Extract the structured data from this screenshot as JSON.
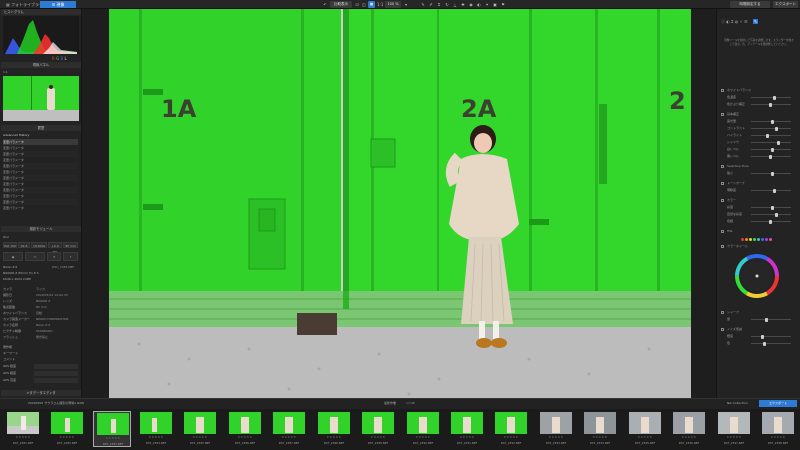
{
  "app": {
    "title": "フォトライブラリ",
    "tab_active": "現像"
  },
  "toolbar": {
    "compare_label": "比較表示",
    "zoom_label": "100 %",
    "right_btn1": "時間設定する",
    "right_btn2": "エクスポート",
    "menu1": "ファイル",
    "menu2": "ナビゲータ"
  },
  "left_panel": {
    "histogram_header": "ヒストグラム",
    "histogram_legend": [
      "R",
      "G",
      "B",
      "L"
    ],
    "navigator_header": "現像パネル",
    "navigator_zoom": "1:1",
    "history_header": "履歴",
    "history_title": "Advanced History",
    "history_items": [
      "変更パラメータ",
      "変更パラメータ",
      "変更パラメータ",
      "変更パラメータ",
      "変更パラメータ",
      "変更パラメータ",
      "変更パラメータ",
      "変更パラメータ",
      "変更パラメータ",
      "変更パラメータ",
      "変更パラメータ",
      "変更パラメータ"
    ],
    "snapshot_header": "撮影モジュール",
    "info_header": "Zoil",
    "camera_buttons": [
      "ISO 100",
      "f/2.8",
      "1/1000s",
      "+0.0 EV",
      "85 mm"
    ],
    "exif": [
      {
        "label": "Nikon Z 6",
        "value": "DSC_2383.NEF"
      },
      {
        "label": "NIKKOR Z 85mm f/1.8 S",
        "value": ""
      },
      {
        "label": "6048 x 4024 24MP",
        "value": ""
      },
      {
        "label": "カメラ",
        "value": "ライカ"
      },
      {
        "label": "撮影日",
        "value": "2020/03/02 14:02:33"
      },
      {
        "label": "レンズ",
        "value": "NIKKOR Z"
      },
      {
        "label": "焦点距離",
        "value": "85 mm"
      },
      {
        "label": "ホワイトバランス",
        "value": "自動"
      },
      {
        "label": "カメラ製造メーカー",
        "value": "NIKON CORPORATION"
      },
      {
        "label": "カメラ名称",
        "value": "Nikon Z 6"
      },
      {
        "label": "ピクチャ制御",
        "value": "STANDARD"
      },
      {
        "label": "フラッシュ",
        "value": "発光禁止"
      },
      {
        "label": "著作権",
        "value": ""
      },
      {
        "label": "キーワード",
        "value": ""
      },
      {
        "label": "コメント",
        "value": ""
      }
    ],
    "gps_rows": [
      "GPS 緯度",
      "GPS 経度",
      "GPS 高度"
    ],
    "bottom_header": "メタデータエディタ"
  },
  "image": {
    "door_labels": [
      "1A",
      "2A",
      "2"
    ]
  },
  "right_panel": {
    "hint_text": "現像ツールを使用して写真を調整します。スライダーを動かして露出、色、ディテールを微調整してください。",
    "sections": [
      {
        "title": "ホワイトバランス",
        "rows": [
          "色温度",
          "色かぶり補正"
        ]
      },
      {
        "title": "基本補正",
        "rows": [
          "露光量",
          "コントラスト",
          "ハイライト",
          "シャドウ",
          "白レベル",
          "黒レベル"
        ]
      },
      {
        "title": "Selective Tone",
        "rows": [
          "強さ"
        ]
      },
      {
        "title": "トーンカーブ",
        "rows": [
          "明瞭度"
        ]
      },
      {
        "title": "カラー",
        "rows": [
          "彩度",
          "自然な彩度",
          "色相"
        ]
      },
      {
        "title": "HSL",
        "rows": []
      },
      {
        "title": "カラーホイール",
        "rows": []
      },
      {
        "title": "シャープ",
        "rows": [
          "量"
        ]
      },
      {
        "title": "ノイズ低減",
        "rows": [
          "輝度",
          "色"
        ]
      }
    ],
    "color_dots": [
      "#e23b3b",
      "#e38b2a",
      "#e3d52a",
      "#4fd13e",
      "#35c6c6",
      "#3a6ee0",
      "#9a45e0",
      "#e04ab3"
    ]
  },
  "filmstrip": {
    "folder": "20200302 サクラさん撮影の現場A RAW",
    "center_title": "最新作業",
    "count": "17/48",
    "collection_label": "Nik Collection",
    "export_label": "エクスポート",
    "files": [
      "DST_2381.NEF",
      "DST_2382.NEF",
      "DST_2383.NEF",
      "DST_2384.NEF",
      "DST_2385.NEF",
      "DST_2386.NEF",
      "DST_2387.NEF",
      "DST_2388.NEF",
      "DST_2389.NEF",
      "DST_2390.NEF",
      "DST_2391.NEF",
      "DST_2392.NEF",
      "DST_2393.NEF",
      "DST_2394.NEF",
      "DST_2395.NEF",
      "DST_2396.NEF",
      "DST_2397.NEF",
      "DST_2398.NEF"
    ],
    "stars": "★★★★★"
  },
  "colors": {
    "accent": "#2e7bd6",
    "door_green": "#31d32b"
  }
}
